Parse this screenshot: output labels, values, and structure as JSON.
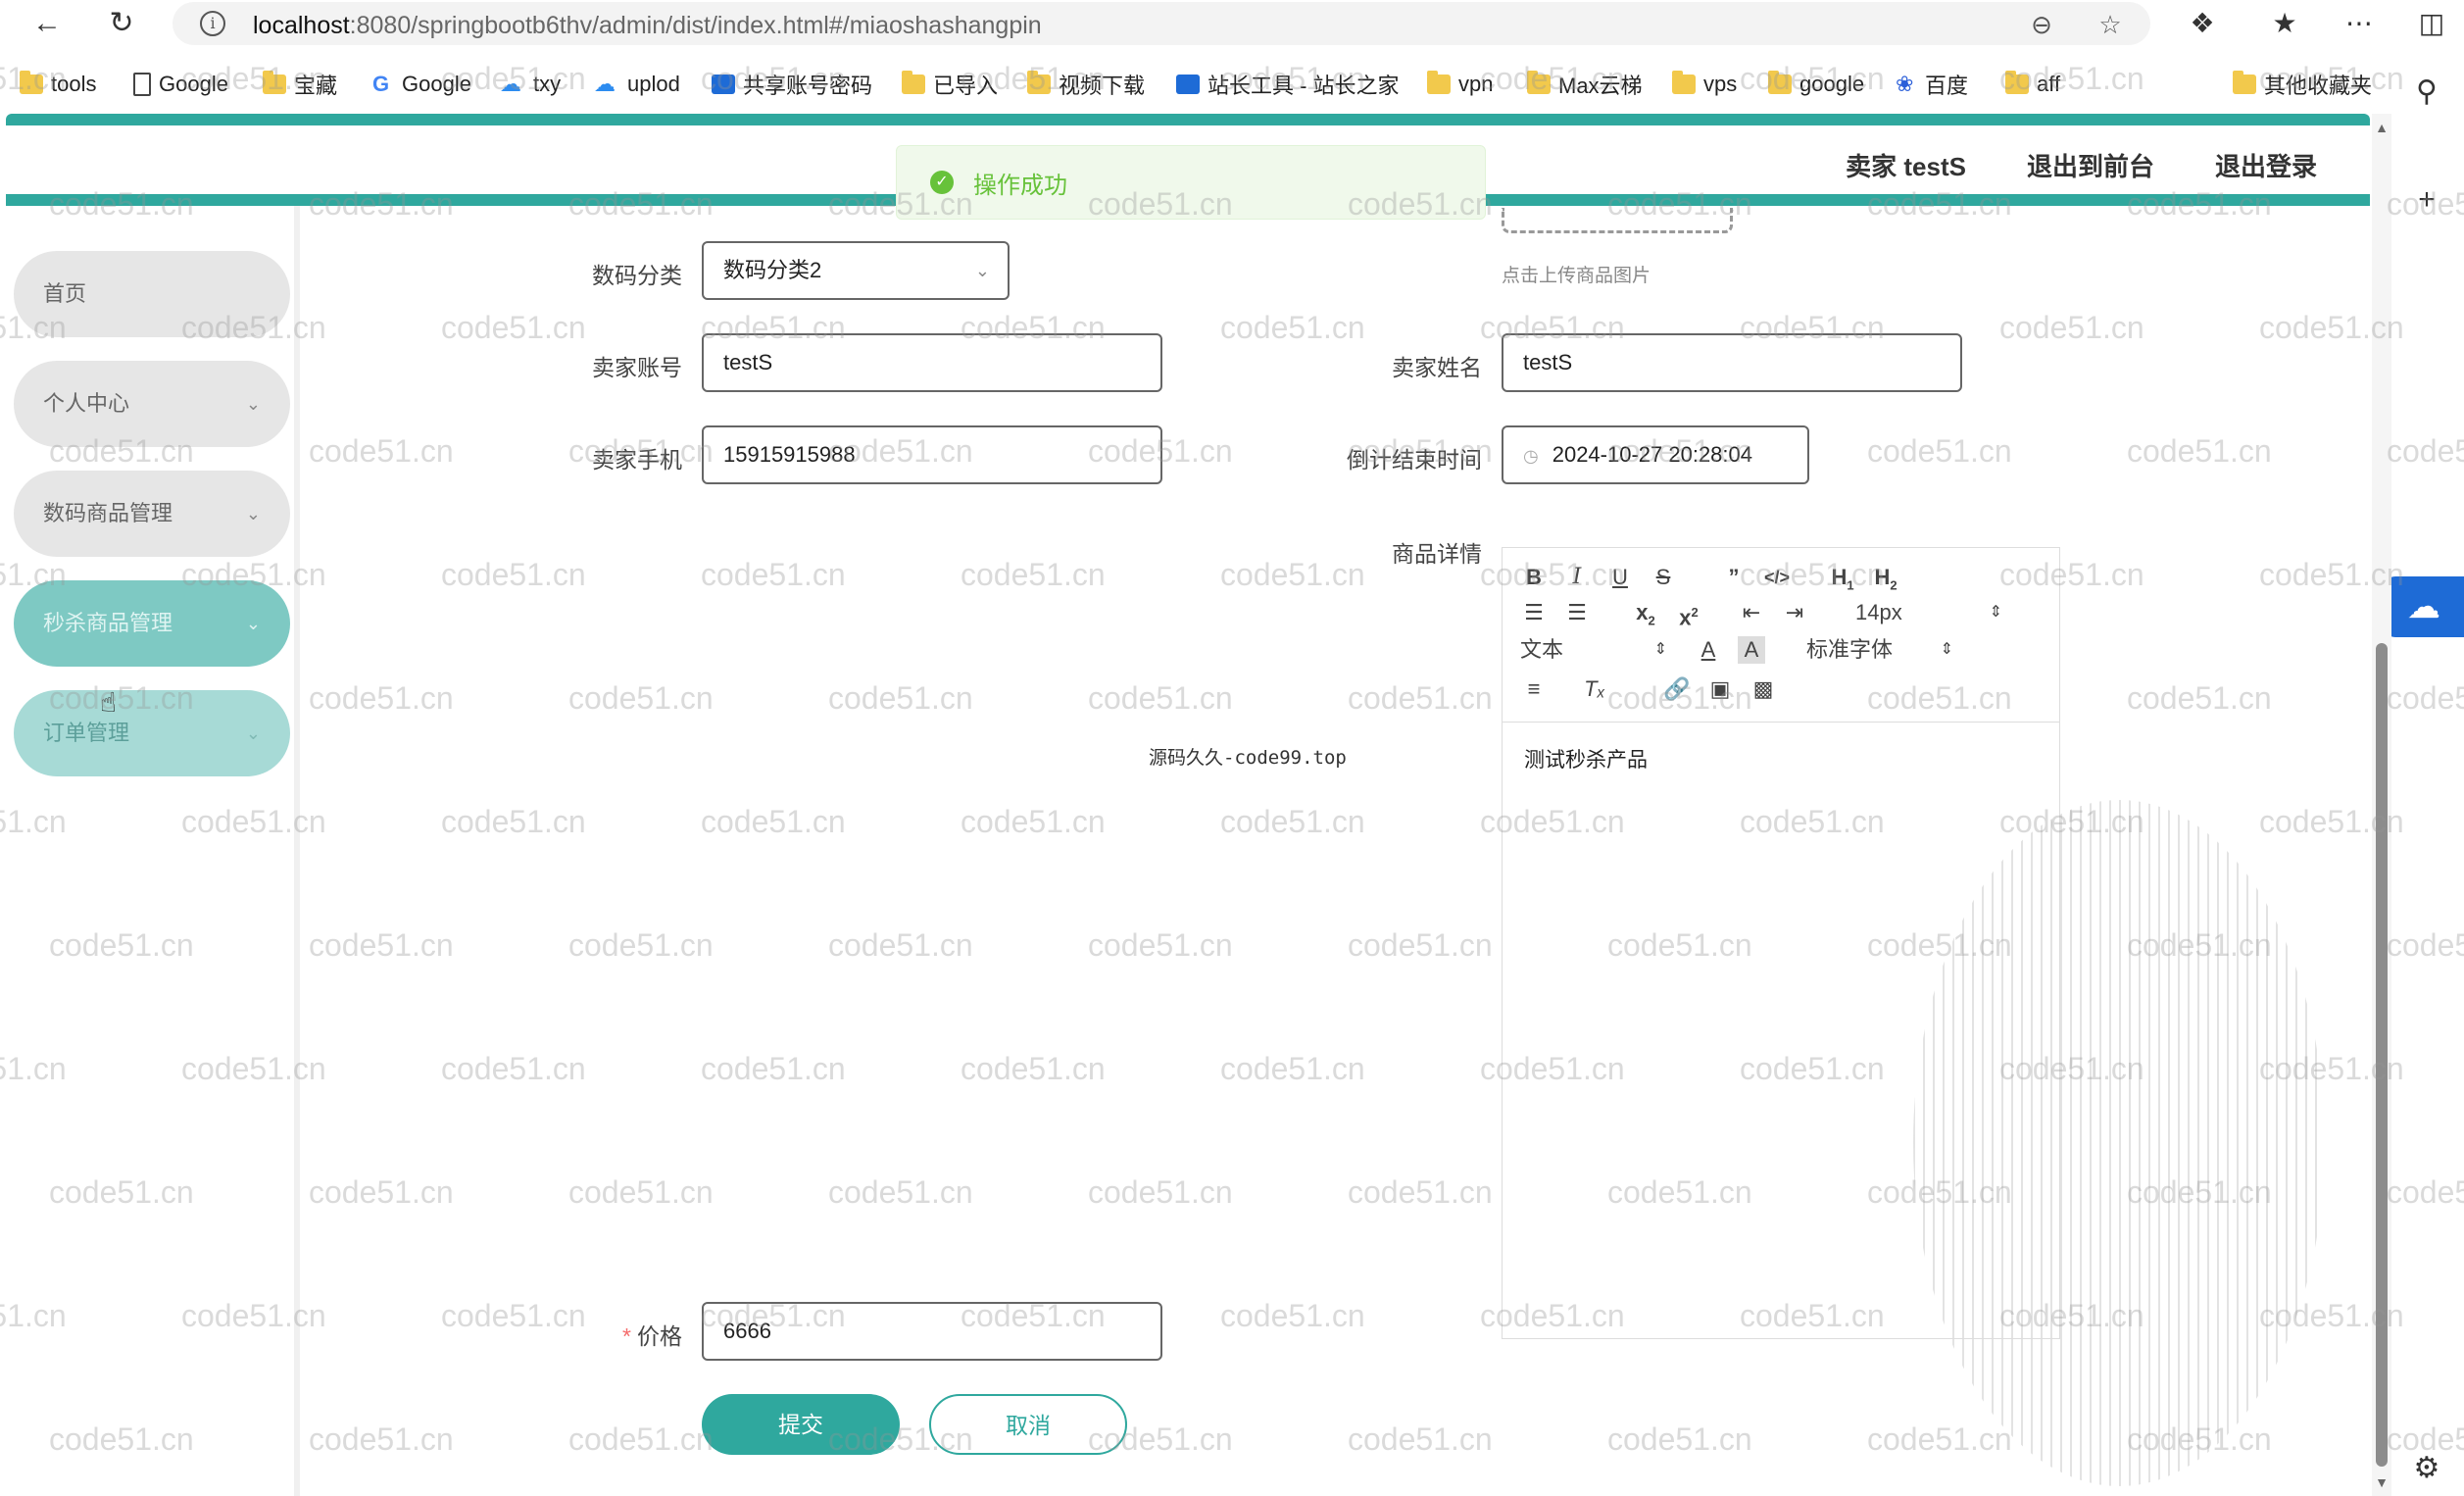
{
  "browser": {
    "url_host": "localhost",
    "url_path": ":8080/springbootb6thv/admin/dist/index.html#/miaoshashangpin",
    "bookmarks": [
      {
        "label": "tools",
        "icon": "folder-icon"
      },
      {
        "label": "Google",
        "icon": "document-icon"
      },
      {
        "label": "宝藏",
        "icon": "folder-icon"
      },
      {
        "label": "Google",
        "icon": "google-icon"
      },
      {
        "label": "txy",
        "icon": "cloud-icon"
      },
      {
        "label": "uplod",
        "icon": "cloud-icon"
      },
      {
        "label": "共享账号密码",
        "icon": "app-icon"
      },
      {
        "label": "已导入",
        "icon": "folder-icon"
      },
      {
        "label": "视频下载",
        "icon": "folder-icon"
      },
      {
        "label": "站长工具 - 站长之家",
        "icon": "app-icon"
      },
      {
        "label": "vpn",
        "icon": "folder-icon"
      },
      {
        "label": "Max云梯",
        "icon": "folder-icon"
      },
      {
        "label": "vps",
        "icon": "folder-icon"
      },
      {
        "label": "google",
        "icon": "folder-icon"
      },
      {
        "label": "百度",
        "icon": "baidu-paw-icon"
      },
      {
        "label": "aff",
        "icon": "folder-icon"
      },
      {
        "label": "其他收藏夹",
        "icon": "folder-icon"
      }
    ]
  },
  "header": {
    "user_label": "卖家 testS",
    "front_link": "退出到前台",
    "logout_link": "退出登录"
  },
  "toast": {
    "message": "操作成功"
  },
  "sidebar": {
    "items": [
      {
        "label": "首页"
      },
      {
        "label": "个人中心"
      },
      {
        "label": "数码商品管理"
      },
      {
        "label": "秒杀商品管理"
      },
      {
        "label": "订单管理"
      }
    ]
  },
  "form": {
    "upload_tip": "点击上传商品图片",
    "category_label": "数码分类",
    "category_value": "数码分类2",
    "seller_account_label": "卖家账号",
    "seller_account_value": "testS",
    "seller_name_label": "卖家姓名",
    "seller_name_value": "testS",
    "seller_phone_label": "卖家手机",
    "seller_phone_value": "15915915988",
    "countdown_label": "倒计结束时间",
    "countdown_value": "2024-10-27 20:28:04",
    "detail_label": "商品详情",
    "price_label": "价格",
    "price_value": "6666",
    "submit_label": "提交",
    "cancel_label": "取消"
  },
  "editor": {
    "font_size": "14px",
    "block_format": "文本",
    "font_family": "标准字体",
    "content": "测试秒杀产品"
  },
  "watermark": {
    "text": "code51.cn",
    "center_text": "源码久久-code99.top"
  }
}
